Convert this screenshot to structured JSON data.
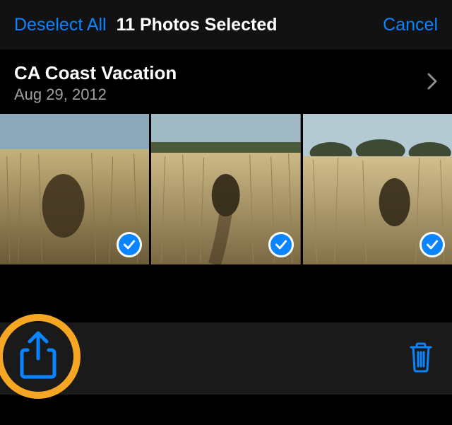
{
  "topbar": {
    "deselect_label": "Deselect All",
    "title": "11 Photos Selected",
    "cancel_label": "Cancel"
  },
  "album": {
    "title": "CA Coast Vacation",
    "date": "Aug 29, 2012"
  },
  "photos": [
    {
      "selected": true
    },
    {
      "selected": true
    },
    {
      "selected": true
    }
  ],
  "icons": {
    "chevron": "chevron-right-icon",
    "check": "checkmark-icon",
    "share": "share-icon",
    "trash": "trash-icon"
  },
  "colors": {
    "accent": "#0a84ff",
    "highlight_ring": "#f5a623"
  }
}
